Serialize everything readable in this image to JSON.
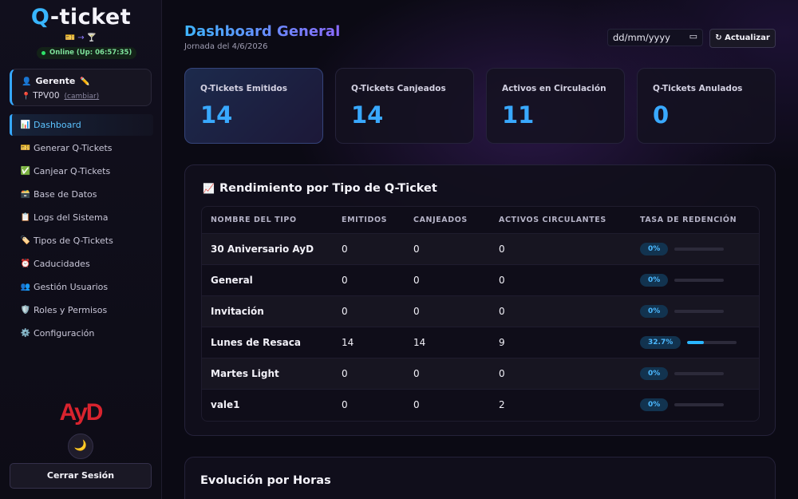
{
  "app": {
    "logo_q": "Q",
    "logo_rest": "-ticket",
    "logo_icons": "🎫 → 🍸",
    "status": "Online (Up: 06:57:35)"
  },
  "user": {
    "role": "Gerente",
    "role_icon": "👤",
    "edit_icon": "✏️",
    "terminal": "TPV00",
    "pin_icon": "📍",
    "change_link": "(cambiar)"
  },
  "nav": [
    {
      "icon": "📊",
      "label": "Dashboard",
      "active": true
    },
    {
      "icon": "🎫",
      "label": "Generar Q-Tickets"
    },
    {
      "icon": "✅",
      "label": "Canjear Q-Tickets"
    },
    {
      "icon": "🗃️",
      "label": "Base de Datos"
    },
    {
      "icon": "📋",
      "label": "Logs del Sistema"
    },
    {
      "icon": "🏷️",
      "label": "Tipos de Q-Tickets"
    },
    {
      "icon": "⏰",
      "label": "Caducidades"
    },
    {
      "icon": "👥",
      "label": "Gestión Usuarios"
    },
    {
      "icon": "🛡️",
      "label": "Roles y Permisos"
    },
    {
      "icon": "⚙️",
      "label": "Configuración"
    }
  ],
  "sidebar_footer": {
    "brand": "AyD",
    "theme_icon": "🌙",
    "logout_label": "Cerrar Sesión"
  },
  "header": {
    "title": "Dashboard General",
    "subtitle": "Jornada del 4/6/2026",
    "date_placeholder": "dd/mm/yyyy",
    "refresh_label": "↻ Actualizar"
  },
  "stats": [
    {
      "label": "Q-Tickets Emitidos",
      "value": "14"
    },
    {
      "label": "Q-Tickets Canjeados",
      "value": "14"
    },
    {
      "label": "Activos en Circulación",
      "value": "11"
    },
    {
      "label": "Q-Tickets Anulados",
      "value": "0"
    }
  ],
  "performance": {
    "title": "Rendimiento por Tipo de Q-Ticket",
    "title_icon": "📈",
    "columns": [
      "Nombre del Tipo",
      "Emitidos",
      "Canjeados",
      "Activos Circulantes",
      "Tasa de Redención"
    ],
    "rows": [
      {
        "name": "30 Aniversario AyD",
        "emitidos": "0",
        "canjeados": "0",
        "activos": "0",
        "tasa": "0%",
        "tasa_value": 0
      },
      {
        "name": "General",
        "emitidos": "0",
        "canjeados": "0",
        "activos": "0",
        "tasa": "0%",
        "tasa_value": 0
      },
      {
        "name": "Invitación",
        "emitidos": "0",
        "canjeados": "0",
        "activos": "0",
        "tasa": "0%",
        "tasa_value": 0
      },
      {
        "name": "Lunes de Resaca",
        "emitidos": "14",
        "canjeados": "14",
        "activos": "9",
        "tasa": "32.7%",
        "tasa_value": 32.7
      },
      {
        "name": "Martes Light",
        "emitidos": "0",
        "canjeados": "0",
        "activos": "0",
        "tasa": "0%",
        "tasa_value": 0
      },
      {
        "name": "vale1",
        "emitidos": "0",
        "canjeados": "0",
        "activos": "2",
        "tasa": "0%",
        "tasa_value": 0
      }
    ]
  },
  "hourly": {
    "title": "Evolución por Horas"
  },
  "colors": {
    "accent": "#39a9ff",
    "purple": "#8b6bff",
    "online": "#2ee36a",
    "brand_red": "#d9232e"
  }
}
